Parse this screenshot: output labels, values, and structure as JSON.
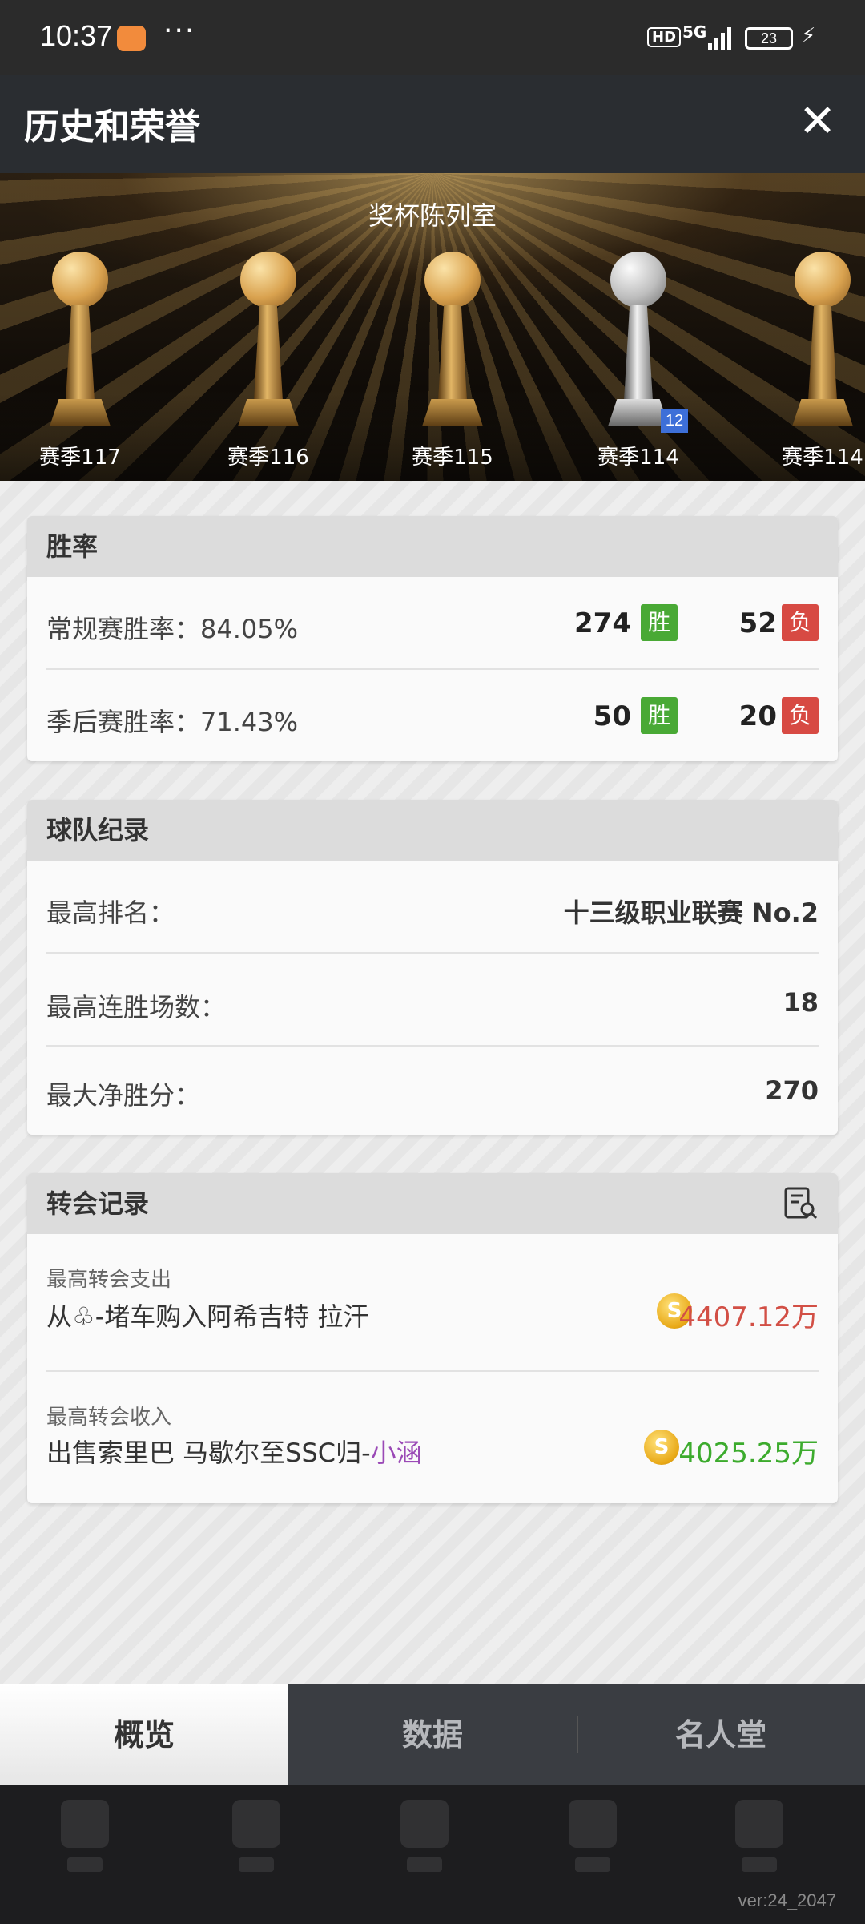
{
  "statusbar": {
    "time": "10:37",
    "dots": "···",
    "hd": "HD",
    "signal": "5G",
    "battery": "23"
  },
  "header": {
    "title": "历史和荣誉",
    "close_label": "✕"
  },
  "banner": {
    "title": "奖杯陈列室",
    "trophies": [
      {
        "label": "赛季117",
        "kind": "gold"
      },
      {
        "label": "赛季116",
        "kind": "gold"
      },
      {
        "label": "赛季115",
        "kind": "gold"
      },
      {
        "label": "赛季114",
        "kind": "silver",
        "badge": "12"
      },
      {
        "label": "赛季114",
        "kind": "gold"
      }
    ]
  },
  "win_rate": {
    "title": "胜率",
    "rows": [
      {
        "label": "常规赛胜率：84.05%",
        "wins": "274",
        "win_tag": "胜",
        "losses": "52",
        "loss_tag": "负"
      },
      {
        "label": "季后赛胜率：71.43%",
        "wins": "50",
        "win_tag": "胜",
        "losses": "20",
        "loss_tag": "负"
      }
    ]
  },
  "team_record": {
    "title": "球队纪录",
    "rows": [
      {
        "label": "最高排名：",
        "value": "十三级职业联赛 No.2"
      },
      {
        "label": "最高连胜场数：",
        "value": "18"
      },
      {
        "label": "最大净胜分：",
        "value": "270"
      }
    ]
  },
  "transfer_record": {
    "title": "转会记录",
    "icon": "search-list-icon",
    "rows": [
      {
        "caption": "最高转会支出",
        "detail": "从♧-堵车购入阿希吉特 拉汗",
        "detail_suffix": "",
        "coin": "S",
        "amount": "4407.12万",
        "color": "#d24f45"
      },
      {
        "caption": "最高转会收入",
        "detail": "出售索里巴 马歇尔至SSC归-",
        "detail_suffix": "小涵",
        "coin": "S",
        "amount": "4025.25万",
        "color": "#3cab2d"
      }
    ]
  },
  "tabs": [
    {
      "label": "概览",
      "active": true
    },
    {
      "label": "数据",
      "active": false
    },
    {
      "label": "名人堂",
      "active": false
    }
  ],
  "version": "ver:24_2047"
}
